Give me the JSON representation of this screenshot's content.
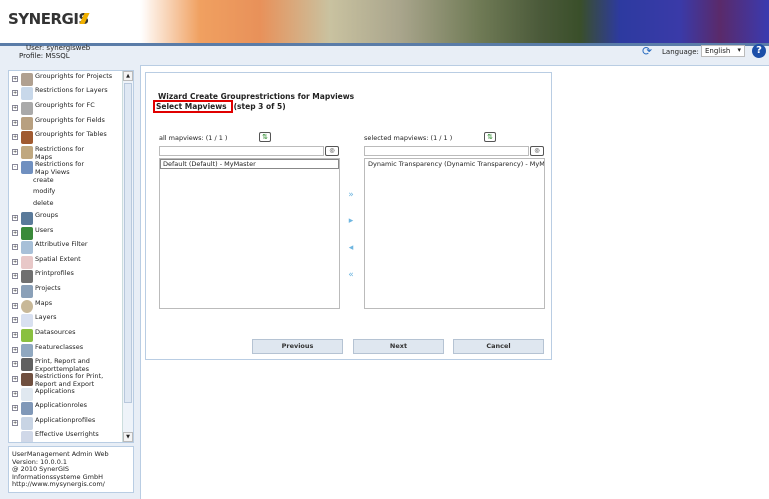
{
  "header": {
    "logo": "SYNERGIS",
    "user": "User: synergisweb",
    "profile": "Profile: MSSQL",
    "language_label": "Language:",
    "language_value": "English",
    "help": "?"
  },
  "sidebar": {
    "items": [
      {
        "label": "Grouprights for Projects",
        "state": "+"
      },
      {
        "label": "Restrictions for Layers",
        "state": "+"
      },
      {
        "label": "Grouprights for FC",
        "state": "+"
      },
      {
        "label": "Grouprights for Fields",
        "state": "+"
      },
      {
        "label": "Grouprights for Tables",
        "state": "+"
      },
      {
        "label": "Restrictions for Maps",
        "state": "+"
      },
      {
        "label": "Restrictions for Map Views",
        "state": "-",
        "children": [
          "create",
          "modify",
          "delete"
        ]
      },
      {
        "label": "Groups",
        "state": "+"
      },
      {
        "label": "Users",
        "state": "+"
      },
      {
        "label": "Attributive Filter",
        "state": "+"
      },
      {
        "label": "Spatial Extent",
        "state": "+"
      },
      {
        "label": "Printprofiles",
        "state": "+"
      },
      {
        "label": "Projects",
        "state": "+"
      },
      {
        "label": "Maps",
        "state": "+"
      },
      {
        "label": "Layers",
        "state": "+"
      },
      {
        "label": "Datasources",
        "state": "+"
      },
      {
        "label": "Featureclasses",
        "state": "+"
      },
      {
        "label": "Print, Report and Exporttemplates",
        "state": "+"
      },
      {
        "label": "Restrictions for Print, Report and Export",
        "state": "+"
      },
      {
        "label": "Applications",
        "state": "+"
      },
      {
        "label": "Applicationroles",
        "state": "+"
      },
      {
        "label": "Applicationprofiles",
        "state": "+"
      },
      {
        "label": "Effective Userrights",
        "state": ""
      }
    ]
  },
  "footer": {
    "line1": "UserManagement Admin Web",
    "line2": "Version: 10.0.0.1",
    "line3": "@ 2010 SynerGIS",
    "line4": "Informationssysteme GmbH",
    "link": "http://www.mysynergis.com/"
  },
  "wizard": {
    "title": "Wizard Create Grouprestrictions for Mapviews",
    "step_highlight": "Select Mapviews",
    "step_rest": "(step 3 of 5)",
    "left": {
      "header": "all mapviews: (1      / 1     )",
      "filter": "",
      "items": [
        "Default (Default) - MyMaster"
      ]
    },
    "right": {
      "header": "selected mapviews: (1      / 1     )",
      "filter": "",
      "items": [
        "Dynamic Transparency (Dynamic Transparency) - MyMaster"
      ]
    },
    "buttons": {
      "previous": "Previous",
      "next": "Next",
      "cancel": "Cancel"
    }
  }
}
